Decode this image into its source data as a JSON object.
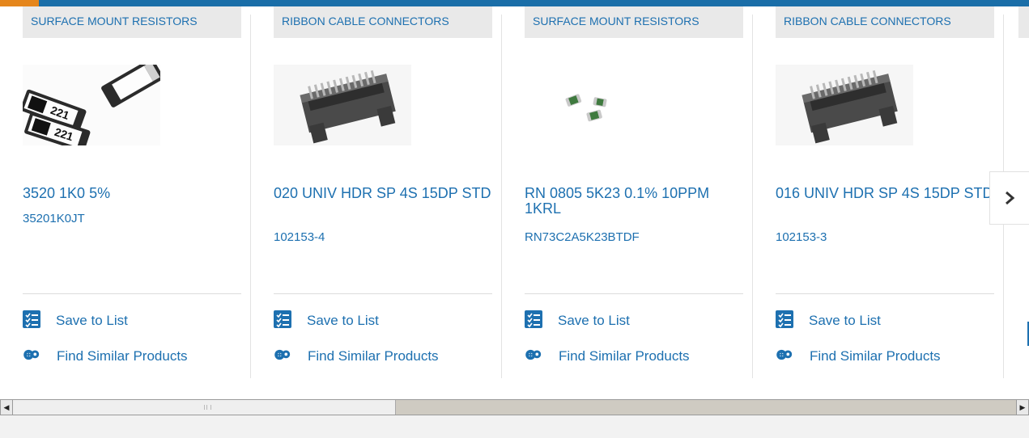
{
  "colors": {
    "accent_blue": "#1d70b0",
    "bar_blue": "#1a6ea8",
    "bar_orange": "#e5861c",
    "category_bg": "#e9e9e9"
  },
  "products": [
    {
      "category": "SURFACE MOUNT RESISTORS",
      "title": "3520 1K0 5%",
      "part_number": "35201K0JT",
      "image": "smd-resistor-large",
      "save_label": "Save to List",
      "similar_label": "Find Similar Products"
    },
    {
      "category": "RIBBON CABLE CONNECTORS",
      "title": "020 UNIV HDR SP 4S 15DP STD",
      "part_number": "102153-4",
      "image": "ribbon-header",
      "save_label": "Save to List",
      "similar_label": "Find Similar Products"
    },
    {
      "category": "SURFACE MOUNT RESISTORS",
      "title": "RN 0805 5K23 0.1% 10PPM 1KRL",
      "part_number": "RN73C2A5K23BTDF",
      "image": "smd-resistor-small",
      "save_label": "Save to List",
      "similar_label": "Find Similar Products"
    },
    {
      "category": "RIBBON CABLE CONNECTORS",
      "title": "016 UNIV HDR SP 4S 15DP STD",
      "part_number": "102153-3",
      "image": "ribbon-header",
      "save_label": "Save to List",
      "similar_label": "Find Similar Products"
    }
  ],
  "icons": {
    "save": "checklist-icon",
    "similar": "gears-icon",
    "next": "chevron-right-icon"
  }
}
